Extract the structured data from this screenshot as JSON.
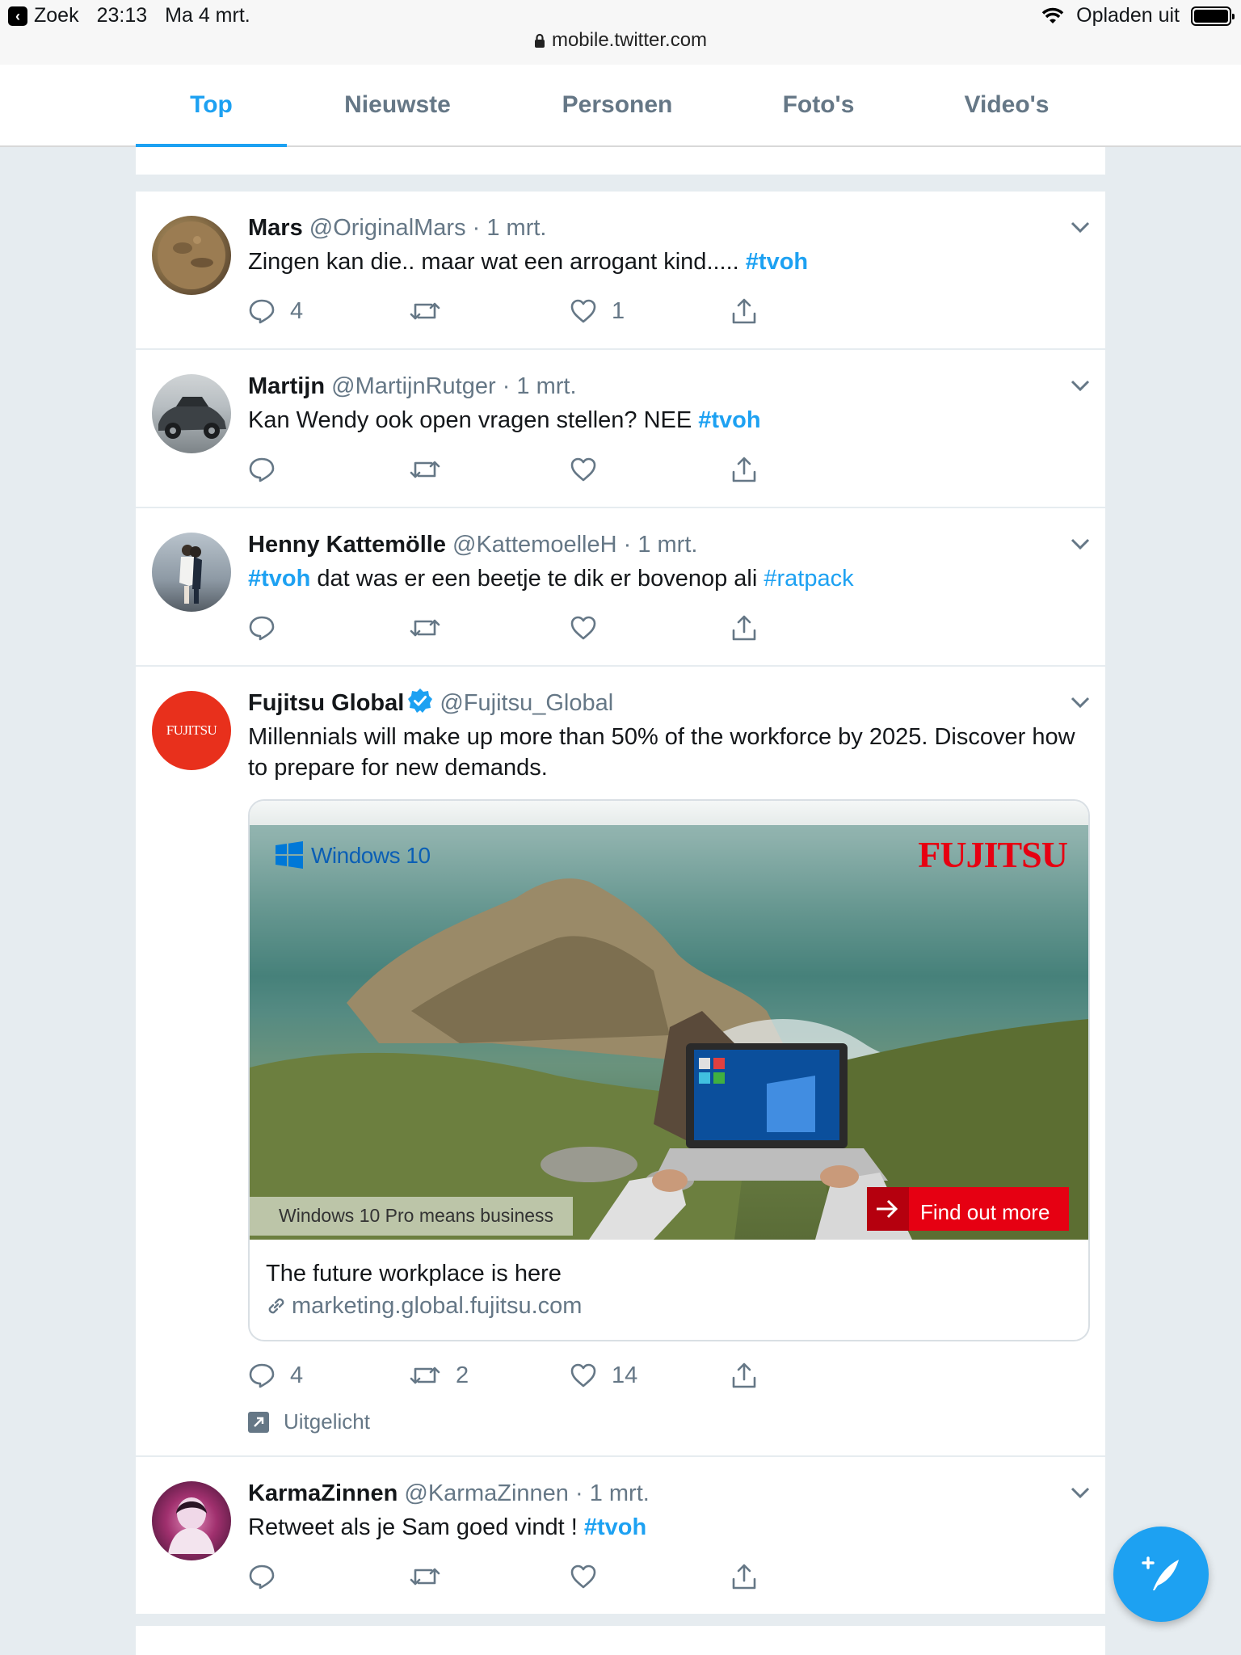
{
  "status_bar": {
    "back_label": "Zoek",
    "time": "23:13",
    "date": "Ma 4 mrt.",
    "charging": "Opladen uit",
    "url": "mobile.twitter.com"
  },
  "tabs": [
    {
      "label": "Top",
      "active": true
    },
    {
      "label": "Nieuwste",
      "active": false
    },
    {
      "label": "Personen",
      "active": false
    },
    {
      "label": "Foto's",
      "active": false
    },
    {
      "label": "Video's",
      "active": false
    }
  ],
  "tweets": [
    {
      "name": "Mars",
      "handle": "@OriginalMars",
      "time": "1 mrt.",
      "text": "Zingen kan die.. maar wat een arrogant kind.....",
      "hashtag_end": "#tvoh",
      "replies": "4",
      "retweets": "",
      "likes": "1"
    },
    {
      "name": "Martijn",
      "handle": "@MartijnRutger",
      "time": "1 mrt.",
      "text": "Kan Wendy ook open vragen stellen? NEE",
      "hashtag_end": "#tvoh",
      "replies": "",
      "retweets": "",
      "likes": ""
    },
    {
      "name": "Henny Kattemölle",
      "handle": "@KattemoelleH",
      "time": "1 mrt.",
      "hashtag_start": "#tvoh",
      "text": "dat was er een beetje te dik er bovenop ali",
      "hashtag_end": "#ratpack",
      "replies": "",
      "retweets": "",
      "likes": ""
    },
    {
      "name": "Fujitsu Global",
      "handle": "@Fujitsu_Global",
      "avatar_label": "FUJITSU",
      "text": "Millennials will make up more than 50% of the workforce by 2025. Discover how to prepare for new demands.",
      "card": {
        "windows_label": "Windows 10",
        "brand_label": "FUJITSU",
        "tagline": "Windows 10 Pro means business",
        "cta": "Find out more",
        "title": "The future workplace is here",
        "link": "marketing.global.fujitsu.com"
      },
      "replies": "4",
      "retweets": "2",
      "likes": "14",
      "promoted_label": "Uitgelicht"
    },
    {
      "name": "KarmaZinnen",
      "handle": "@KarmaZinnen",
      "time": "1 mrt.",
      "text": "Retweet als je Sam goed vindt !",
      "hashtag_end": "#tvoh",
      "replies": "",
      "retweets": "",
      "likes": ""
    }
  ],
  "colors": {
    "accent": "#1da1f2",
    "secondary_text": "#657786",
    "background": "#e6ecf0",
    "fujitsu_red": "#e60012"
  }
}
